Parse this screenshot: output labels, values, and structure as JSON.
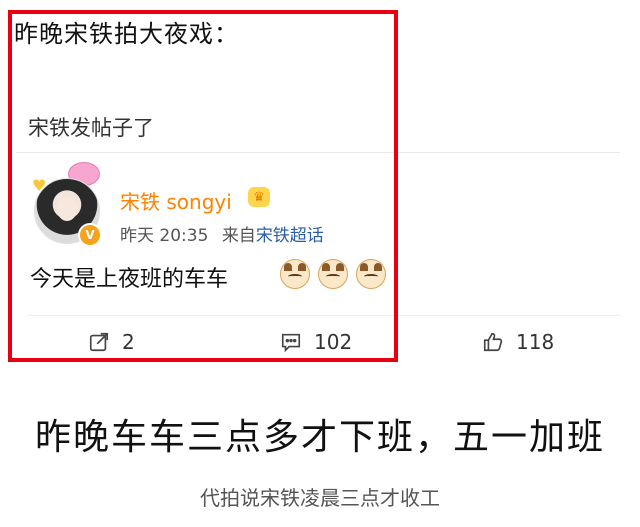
{
  "screenshot": {
    "headline": "昨晚宋铁拍大夜戏：",
    "note": "宋铁发帖子了",
    "post": {
      "username": "宋铁 songyi",
      "time": "昨天 20:35",
      "source_prefix": "来自",
      "source_link": "宋铁超话",
      "body": "今天是上夜班的车车",
      "verified_badge": "V",
      "actions": {
        "share_count": "2",
        "comment_count": "102",
        "like_count": "118"
      }
    }
  },
  "article": {
    "caption": "昨晚车车三点多才下班，五一加班",
    "sub_caption": "代拍说宋铁凌晨三点才收工"
  },
  "colors": {
    "highlight_frame": "#e60012",
    "username": "#ff8200",
    "link": "#2b5ea8"
  },
  "icons": [
    "share-icon",
    "comment-icon",
    "thumbs-up-icon",
    "crown-icon",
    "cat-emoji"
  ]
}
